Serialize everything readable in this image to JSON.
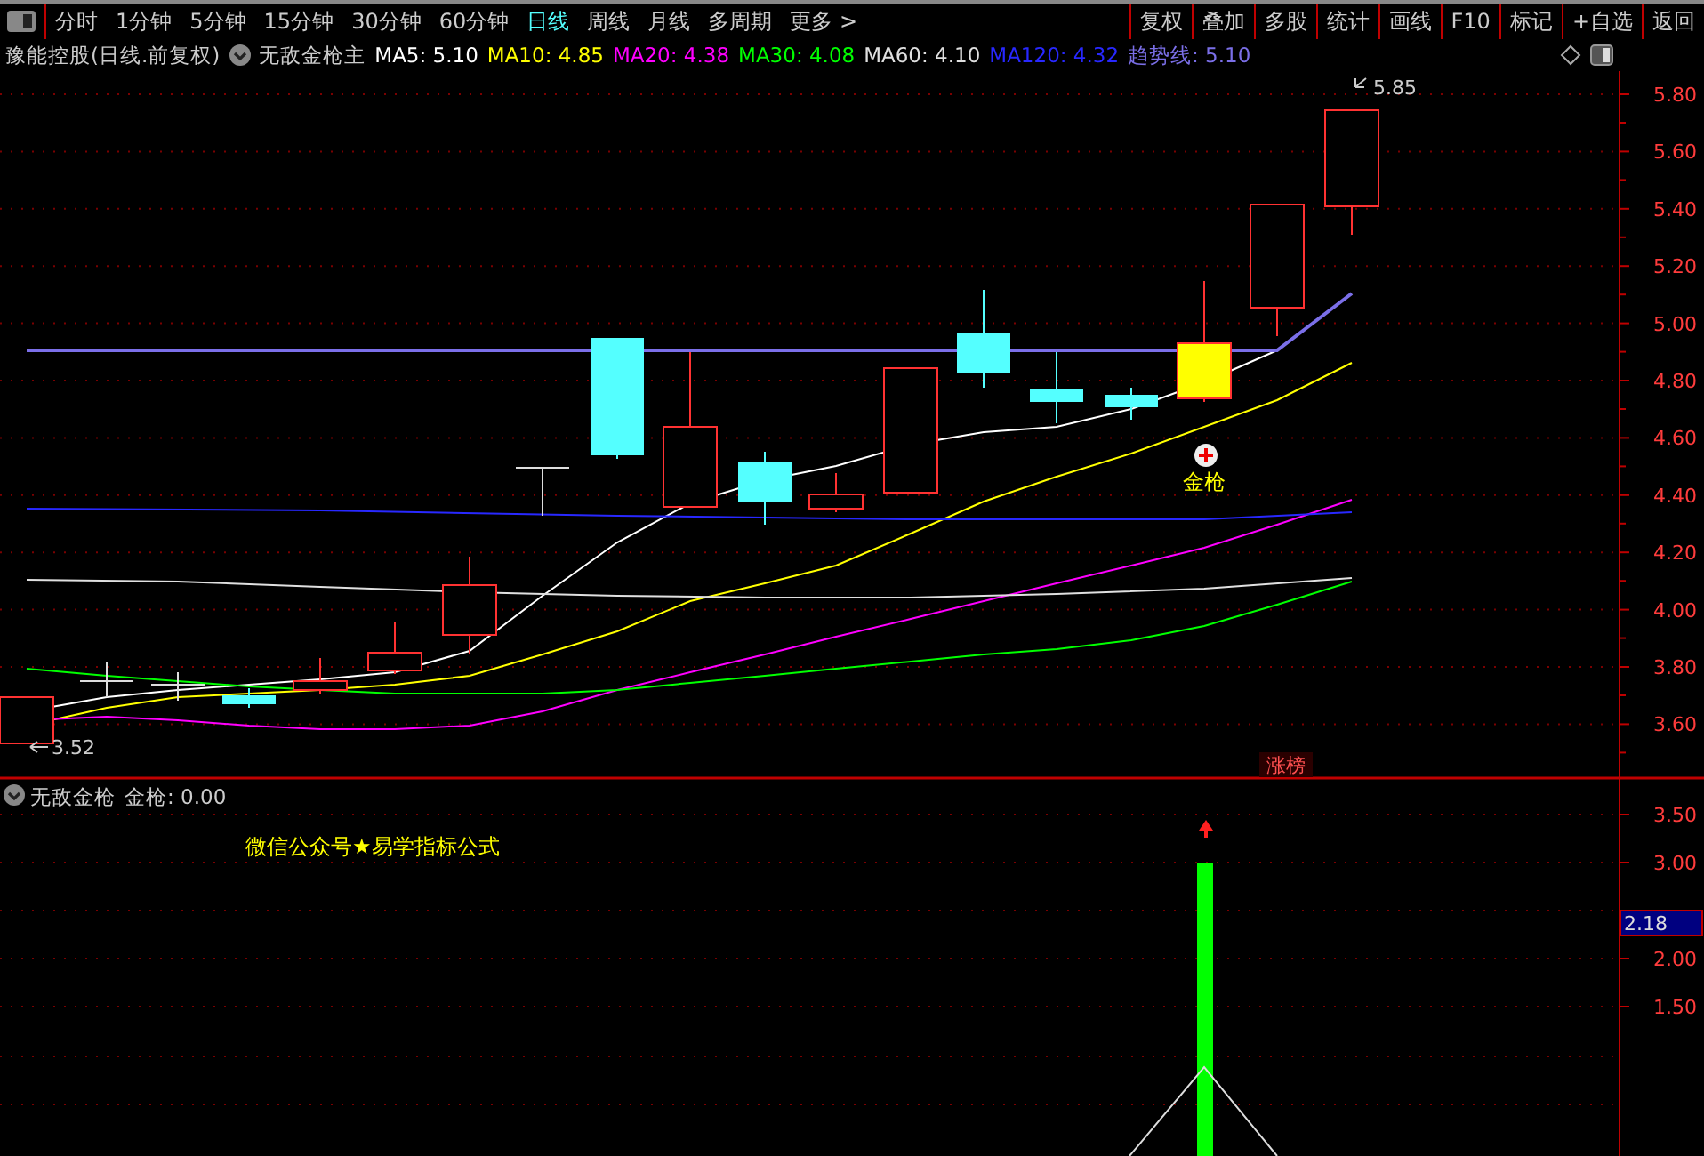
{
  "toolbar": {
    "periods": [
      {
        "label": "分时",
        "selected": false
      },
      {
        "label": "1分钟",
        "selected": false
      },
      {
        "label": "5分钟",
        "selected": false
      },
      {
        "label": "15分钟",
        "selected": false
      },
      {
        "label": "30分钟",
        "selected": false
      },
      {
        "label": "60分钟",
        "selected": false
      },
      {
        "label": "日线",
        "selected": true
      },
      {
        "label": "周线",
        "selected": false
      },
      {
        "label": "月线",
        "selected": false
      },
      {
        "label": "多周期",
        "selected": false
      },
      {
        "label": "更多 >",
        "selected": false
      }
    ],
    "actions": [
      "复权",
      "叠加",
      "多股",
      "统计",
      "画线",
      "F10",
      "标记",
      "+自选",
      "返回"
    ]
  },
  "info_bar": {
    "stock": "豫能控股(日线.前复权)",
    "indicator": "无敌金枪主",
    "values": [
      {
        "label": "MA5: 5.10",
        "color": "#ffffff"
      },
      {
        "label": "MA10: 4.85",
        "color": "#ffff00"
      },
      {
        "label": "MA20: 4.38",
        "color": "#ff00ff"
      },
      {
        "label": "MA30: 4.08",
        "color": "#00ff00"
      },
      {
        "label": "MA60: 4.10",
        "color": "#e0e0e0"
      },
      {
        "label": "MA120: 4.32",
        "color": "#2828ff"
      },
      {
        "label": "趋势线: 5.10",
        "color": "#7b6fe8"
      }
    ]
  },
  "main_chart": {
    "price_axis": [
      "5.80",
      "5.60",
      "5.40",
      "5.20",
      "5.00",
      "4.80",
      "4.60",
      "4.40",
      "4.20",
      "4.00",
      "3.80",
      "3.60"
    ],
    "high_label": "5.85",
    "low_label": "3.52",
    "signal_label": "金枪",
    "tag": "涨榜"
  },
  "sub_chart": {
    "indicator": "无敌金枪",
    "reading": "金枪: 0.00",
    "note": "微信公众号★易学指标公式",
    "axis": [
      "3.50",
      "3.00",
      "2.00",
      "1.50"
    ],
    "current_value": "2.18"
  }
}
